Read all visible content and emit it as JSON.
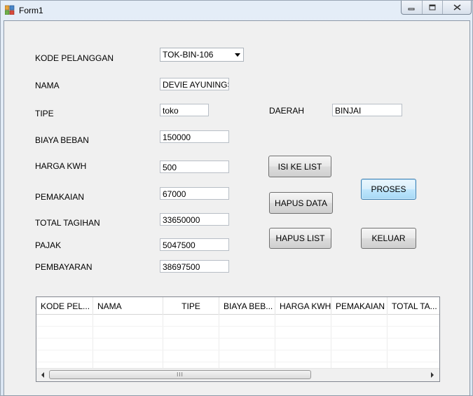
{
  "window": {
    "title": "Form1"
  },
  "form": {
    "kode_pelanggan": {
      "label": "KODE PELANGGAN",
      "value": "TOK-BIN-106"
    },
    "nama": {
      "label": "NAMA",
      "value": "DEVIE AYUNINGSI"
    },
    "tipe": {
      "label": "TIPE",
      "value": "toko"
    },
    "daerah": {
      "label": "DAERAH",
      "value": "BINJAI"
    },
    "biaya_beban": {
      "label": "BIAYA BEBAN",
      "value": "150000"
    },
    "harga_kwh": {
      "label": "HARGA KWH",
      "value": "500"
    },
    "pemakaian": {
      "label": "PEMAKAIAN",
      "value": "67000"
    },
    "total_tagihan": {
      "label": "TOTAL TAGIHAN",
      "value": "33650000"
    },
    "pajak": {
      "label": "PAJAK",
      "value": "5047500"
    },
    "pembayaran": {
      "label": "PEMBAYARAN",
      "value": "38697500"
    }
  },
  "buttons": {
    "isi_ke_list": "ISI KE LIST",
    "proses": "PROSES",
    "hapus_data": "HAPUS DATA",
    "hapus_list": "HAPUS LIST",
    "keluar": "KELUAR"
  },
  "listview": {
    "columns": [
      "KODE PEL...",
      "NAMA",
      "TIPE",
      "BIAYA BEB...",
      "HARGA KWH",
      "PEMAKAIAN",
      "TOTAL TA..."
    ],
    "rows": [],
    "scroll_grip": "III"
  }
}
